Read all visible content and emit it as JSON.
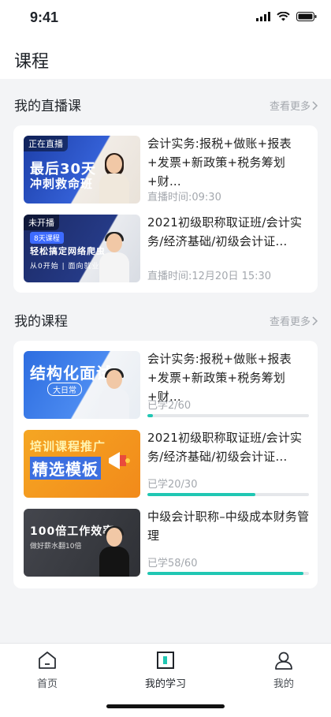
{
  "status": {
    "time": "9:41"
  },
  "header": {
    "title": "课程"
  },
  "live_section": {
    "title": "我的直播课",
    "more": "查看更多",
    "items": [
      {
        "title": "会计实务:报税+做账+报表+发票+新政策+税务筹划+财...",
        "meta": "直播时间:09:30",
        "thumb_tag": "正在直播",
        "thumb_headline": "最后30天",
        "thumb_subline": "冲刺救命班",
        "thumb_accent": "#3460d6"
      },
      {
        "title": "2021初级职称取证班/会计实务/经济基础/初级会计证...",
        "meta": "直播时间:12月20日 15:30",
        "thumb_tag": "未开播",
        "thumb_badge": "8天课程",
        "thumb_headline": "轻松搞定网络爬虫",
        "thumb_subline": "从0开始 | 面向就业",
        "thumb_accent": "#253a86"
      }
    ]
  },
  "course_section": {
    "title": "我的课程",
    "more": "查看更多",
    "items": [
      {
        "title": "会计实务:报税+做账+报表+发票+新政策+税务筹划+财...",
        "progress_text": "已学2/60",
        "progress": 0.033,
        "thumb_headline": "结构化面试",
        "thumb_subline": "大日常"
      },
      {
        "title": "2021初级职称取证班/会计实务/经济基础/初级会计证...",
        "progress_text": "已学20/30",
        "progress": 0.667,
        "thumb_headline": "培训课程推广",
        "thumb_subline": "精选模板"
      },
      {
        "title": "中级会计职称–中级成本财务管理",
        "progress_text": "已学58/60",
        "progress": 0.967,
        "thumb_headline": "100倍工作效率",
        "thumb_subline": "做好薪水翻10倍"
      }
    ]
  },
  "tabs": [
    {
      "label": "首页",
      "icon": "home-icon"
    },
    {
      "label": "我的学习",
      "icon": "study-icon",
      "active": true
    },
    {
      "label": "我的",
      "icon": "profile-icon"
    }
  ],
  "colors": {
    "accent": "#20c7b3",
    "muted": "#a4a8ae",
    "track": "#e5e7ea"
  }
}
